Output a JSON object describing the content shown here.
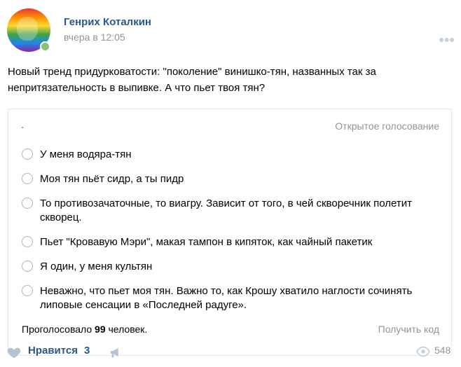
{
  "post": {
    "author": "Генрих Коталкин",
    "time": "вчера в 12:05",
    "text": "Новый тренд придурковатости: \"поколение\" винишко-тян, названных так за непритязательность в выпивке. А что пьет твоя тян?"
  },
  "poll": {
    "title": ".",
    "type": "Открытое голосование",
    "options": [
      {
        "label": "У меня водяра-тян"
      },
      {
        "label": "Моя тян пьёт сидр, а ты пидр"
      },
      {
        "label": "То противозачаточные, то виагру. Зависит от того, в чей скворечник полетит скворец."
      },
      {
        "label": "Пьет \"Кровавую Мэри\", макая тампон в кипяток, как чайный пакетик"
      },
      {
        "label": "Я один, у меня культян"
      },
      {
        "label": "Неважно, что пьет моя тян. Важно то, как Крошу хватило наглости сочинять липовые сенсации в «Последней радуге»."
      }
    ],
    "voters_prefix": "Проголосовало",
    "voters_count": "99",
    "voters_suffix": "человек.",
    "get_code": "Получить код"
  },
  "footer": {
    "like_label": "Нравится",
    "like_count": "3",
    "views": "548"
  },
  "icons": {
    "more": "more-dots-icon",
    "like": "heart-icon",
    "share": "megaphone-icon",
    "views": "eye-icon"
  },
  "colors": {
    "link": "#2a5885",
    "muted": "#939393",
    "online": "#8ac176"
  }
}
